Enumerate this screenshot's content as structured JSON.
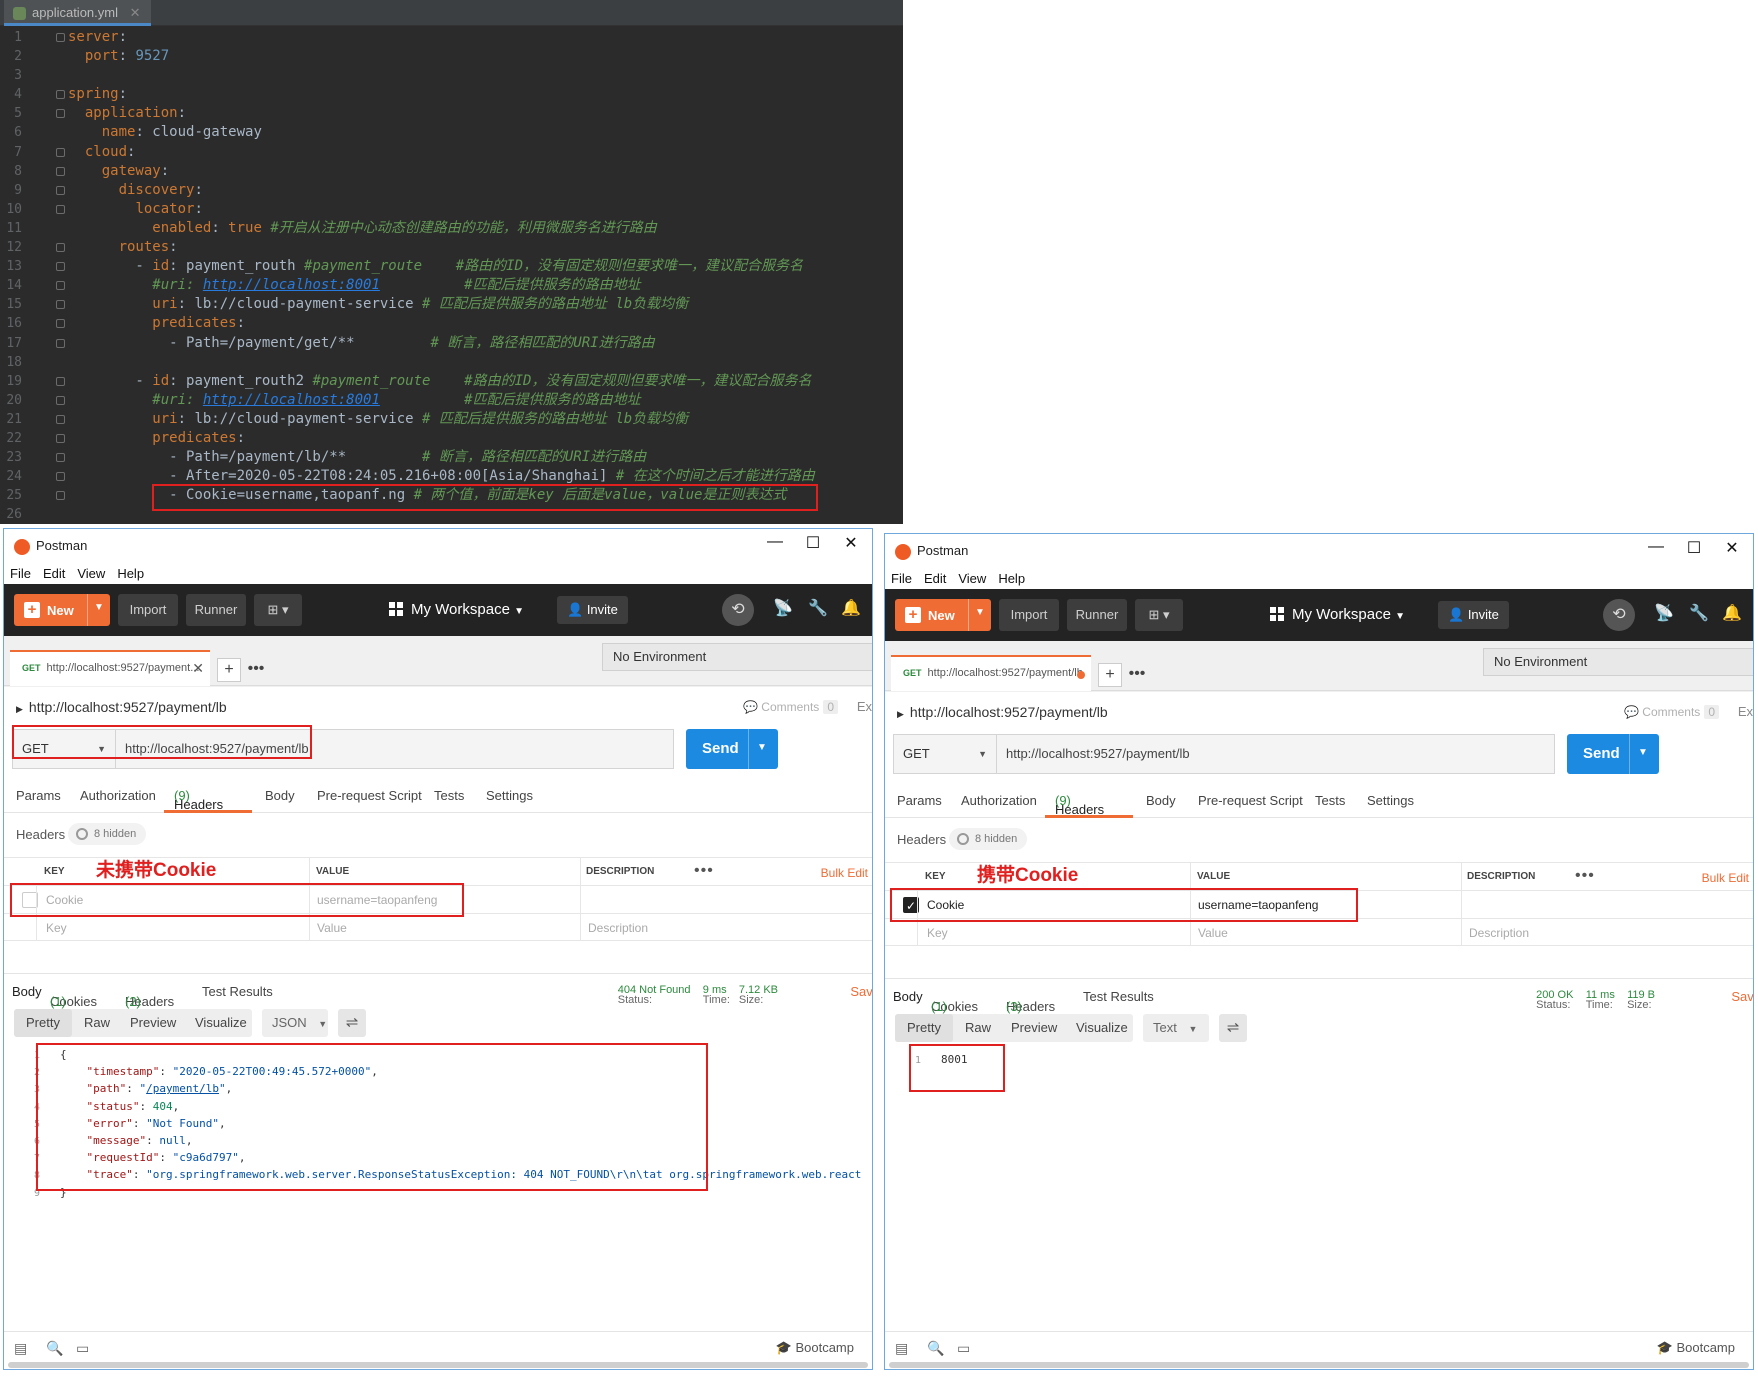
{
  "ide": {
    "tab_label": "application.yml",
    "tab_close": "✕",
    "lines": [
      {
        "n": "1",
        "html": "<span class='k'>server</span>:"
      },
      {
        "n": "2",
        "html": "  <span class='k'>port</span>: <span class='n'>9527</span>"
      },
      {
        "n": "3",
        "html": ""
      },
      {
        "n": "4",
        "html": "<span class='k'>spring</span>:"
      },
      {
        "n": "5",
        "html": "  <span class='k'>application</span>:"
      },
      {
        "n": "6",
        "html": "    <span class='k'>name</span>: cloud-gateway"
      },
      {
        "n": "7",
        "html": "  <span class='k'>cloud</span>:"
      },
      {
        "n": "8",
        "html": "    <span class='k'>gateway</span>:"
      },
      {
        "n": "9",
        "html": "      <span class='k'>discovery</span>:"
      },
      {
        "n": "10",
        "html": "        <span class='k'>locator</span>:"
      },
      {
        "n": "11",
        "html": "          <span class='k'>enabled</span>: <span class='k'>true</span> <span class='c'>#开启从注册中心动态创建路由的功能，利用微服务名进行路由</span>"
      },
      {
        "n": "12",
        "html": "      <span class='k'>routes</span>:"
      },
      {
        "n": "13",
        "html": "        - <span class='k'>id</span>: payment_routh <span class='c'>#payment_route    #路由的ID，没有固定规则但要求唯一，建议配合服务名</span>"
      },
      {
        "n": "14",
        "html": "          <span class='c'>#uri: </span><span class='link'>http://localhost:8001</span><span class='c'>          #匹配后提供服务的路由地址</span>"
      },
      {
        "n": "15",
        "html": "          <span class='k'>uri</span>: lb://cloud-payment-service <span class='c'># 匹配后提供服务的路由地址 lb负载均衡</span>"
      },
      {
        "n": "16",
        "html": "          <span class='k'>predicates</span>:"
      },
      {
        "n": "17",
        "html": "            - Path=/payment/get/**         <span class='c'># 断言，路径相匹配的URI进行路由</span>"
      },
      {
        "n": "18",
        "html": ""
      },
      {
        "n": "19",
        "html": "        - <span class='k'>id</span>: payment_routh2 <span class='c'>#payment_route    #路由的ID，没有固定规则但要求唯一，建议配合服务名</span>"
      },
      {
        "n": "20",
        "html": "          <span class='c'>#uri: </span><span class='link'>http://localhost:8001</span><span class='c'>          #匹配后提供服务的路由地址</span>"
      },
      {
        "n": "21",
        "html": "          <span class='k'>uri</span>: lb://cloud-payment-service <span class='c'># 匹配后提供服务的路由地址 lb负载均衡</span>"
      },
      {
        "n": "22",
        "html": "          <span class='k'>predicates</span>:"
      },
      {
        "n": "23",
        "html": "            - Path=/payment/lb/**         <span class='c'># 断言，路径相匹配的URI进行路由</span>"
      },
      {
        "n": "24",
        "html": "            - After=2020-05-22T08:24:05.216+08:00[Asia/Shanghai] <span class='c'># 在这个时间之后才能进行路由</span>"
      },
      {
        "n": "25",
        "html": "            - Cookie=username,taopanf.ng <span class='c'># 两个值，前面是key 后面是value，value是正则表达式</span>"
      },
      {
        "n": "26",
        "html": ""
      }
    ]
  },
  "windows": [
    {
      "title": "Postman",
      "menu": [
        "File",
        "Edit",
        "View",
        "Help"
      ],
      "toolbar": {
        "new": "New",
        "import": "Import",
        "runner": "Runner",
        "workspace": "My Workspace",
        "invite": "Invite"
      },
      "tab": {
        "method": "GET",
        "url": "http://localhost:9527/payment..."
      },
      "env": "No Environment",
      "breadcrumb": "http://localhost:9527/payment/lb",
      "comments": "Comments",
      "comments_count": "0",
      "edge": "Ex",
      "request": {
        "method": "GET",
        "url": "http://localhost:9527/payment/lb",
        "send": "Send"
      },
      "req_tabs": {
        "params": "Params",
        "auth": "Authorization",
        "headers": "Headers",
        "headers_count": "(9)",
        "body": "Body",
        "pre": "Pre-request Script",
        "tests": "Tests",
        "settings": "Settings"
      },
      "headers_label": "Headers",
      "hidden": "8 hidden",
      "cols": {
        "key": "KEY",
        "value": "VALUE",
        "description": "DESCRIPTION"
      },
      "bulk": "Bulk Edit",
      "row": {
        "key": "Cookie",
        "value": "username=taopanfeng",
        "checked": false
      },
      "placeholders": {
        "key": "Key",
        "value": "Value",
        "description": "Description"
      },
      "annotation": "未携带Cookie",
      "resp_tabs": {
        "body": "Body",
        "cookies": "Cookies",
        "cookies_count": "(1)",
        "headers": "Headers",
        "headers_count": "(2)",
        "tests": "Test Results"
      },
      "status": {
        "label": "Status:",
        "value": "404 Not Found",
        "time_label": "Time:",
        "time": "9 ms",
        "size_label": "Size:",
        "size": "7.12 KB",
        "save": "Save"
      },
      "view": {
        "pretty": "Pretty",
        "raw": "Raw",
        "preview": "Preview",
        "visualize": "Visualize",
        "format": "JSON"
      },
      "footer": {
        "bootcamp": "Bootcamp"
      }
    },
    {
      "title": "Postman",
      "menu": [
        "File",
        "Edit",
        "View",
        "Help"
      ],
      "toolbar": {
        "new": "New",
        "import": "Import",
        "runner": "Runner",
        "workspace": "My Workspace",
        "invite": "Invite"
      },
      "tab": {
        "method": "GET",
        "url": "http://localhost:9527/payment/lb"
      },
      "env": "No Environment",
      "breadcrumb": "http://localhost:9527/payment/lb",
      "comments": "Comments",
      "comments_count": "0",
      "edge": "Ex",
      "request": {
        "method": "GET",
        "url": "http://localhost:9527/payment/lb",
        "send": "Send"
      },
      "req_tabs": {
        "params": "Params",
        "auth": "Authorization",
        "headers": "Headers",
        "headers_count": "(9)",
        "body": "Body",
        "pre": "Pre-request Script",
        "tests": "Tests",
        "settings": "Settings"
      },
      "headers_label": "Headers",
      "hidden": "8 hidden",
      "cols": {
        "key": "KEY",
        "value": "VALUE",
        "description": "DESCRIPTION"
      },
      "bulk": "Bulk Edit",
      "row": {
        "key": "Cookie",
        "value": "username=taopanfeng",
        "checked": true
      },
      "placeholders": {
        "key": "Key",
        "value": "Value",
        "description": "Description"
      },
      "annotation": "携带Cookie",
      "resp_tabs": {
        "body": "Body",
        "cookies": "Cookies",
        "cookies_count": "(1)",
        "headers": "Headers",
        "headers_count": "(3)",
        "tests": "Test Results"
      },
      "status": {
        "label": "Status:",
        "value": "200 OK",
        "time_label": "Time:",
        "time": "11 ms",
        "size_label": "Size:",
        "size": "119 B",
        "save": "Save"
      },
      "view": {
        "pretty": "Pretty",
        "raw": "Raw",
        "preview": "Preview",
        "visualize": "Visualize",
        "format": "Text"
      },
      "footer": {
        "bootcamp": "Bootcamp"
      }
    }
  ],
  "response_left": [
    {
      "n": "1",
      "html": "{"
    },
    {
      "n": "2",
      "html": "    <span class='rk'>\"timestamp\"</span>: <span class='rs'>\"2020-05-22T00:49:45.572+0000\"</span>,"
    },
    {
      "n": "3",
      "html": "    <span class='rk'>\"path\"</span>: <span class='rs'>\"</span><span class='rl'>/payment/lb</span><span class='rs'>\"</span>,"
    },
    {
      "n": "4",
      "html": "    <span class='rk'>\"status\"</span>: <span class='rn'>404</span>,"
    },
    {
      "n": "5",
      "html": "    <span class='rk'>\"error\"</span>: <span class='rs'>\"Not Found\"</span>,"
    },
    {
      "n": "6",
      "html": "    <span class='rk'>\"message\"</span>: <span class='rs'>null</span>,"
    },
    {
      "n": "7",
      "html": "    <span class='rk'>\"requestId\"</span>: <span class='rs'>\"c9a6d797\"</span>,"
    },
    {
      "n": "8",
      "html": "    <span class='rk'>\"trace\"</span>: <span class='rs'>\"org.springframework.web.server.ResponseStatusException: 404 NOT_FOUND\\r\\n\\tat org.springframework.web.react</span>"
    },
    {
      "n": "9",
      "html": "}"
    }
  ],
  "response_right": [
    {
      "n": "1",
      "text": "8001"
    }
  ],
  "colors": {
    "accent": "#ef6c35",
    "send": "#1c8ae0",
    "annotation": "#e01f1f",
    "ok": "#2d8a3e"
  }
}
